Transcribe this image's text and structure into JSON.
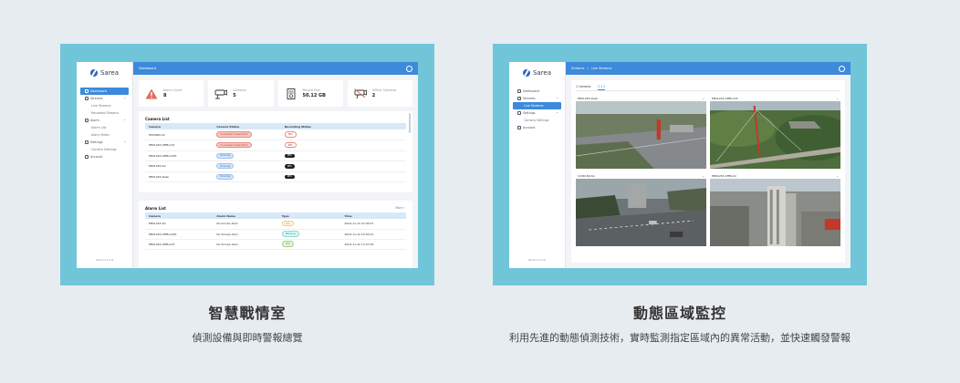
{
  "left": {
    "sidebar": {
      "brand": "Sarea",
      "items": [
        {
          "label": "Dashboard"
        },
        {
          "label": "Streams"
        },
        {
          "label": "Live Streams"
        },
        {
          "label": "Recorded Streams"
        },
        {
          "label": "Alarm"
        },
        {
          "label": "Alarm List"
        },
        {
          "label": "Alarm Rules"
        },
        {
          "label": "Settings"
        },
        {
          "label": "Camera Settings"
        },
        {
          "label": "Account"
        }
      ],
      "version": "Version 1.0.6"
    },
    "topbar": {
      "title": "Dashboard"
    },
    "stats": [
      {
        "label": "Alarm Count",
        "value": "8",
        "icon": "alarm-icon"
      },
      {
        "label": "Cameras",
        "value": "5",
        "icon": "camera-icon"
      },
      {
        "label": "Record Size",
        "value": "50.12 GB",
        "icon": "file-icon"
      },
      {
        "label": "Offline Cameras",
        "value": "2",
        "icon": "camera-off-icon"
      }
    ],
    "camera_list": {
      "title": "Camera List",
      "headers": [
        "Camera",
        "Camera Status",
        "Recording Status"
      ],
      "rows": [
        {
          "camera": "EPSONM-32",
          "status": "Connected Invalid Error",
          "status_color": "red",
          "recording": "REC",
          "rec_style": "off"
        },
        {
          "camera": "EB01265-OffBuild7",
          "status": "Connected Invalid Error",
          "status_color": "red",
          "recording": "REC",
          "rec_style": "off"
        },
        {
          "camera": "EB01265-OffBuild18",
          "status": "Running",
          "status_color": "blue",
          "recording": "REC",
          "rec_style": "on"
        },
        {
          "camera": "EB01265-SG",
          "status": "Running",
          "status_color": "blue",
          "recording": "REC",
          "rec_style": "on"
        },
        {
          "camera": "EB01265-Desk",
          "status": "Running",
          "status_color": "blue",
          "recording": "REC",
          "rec_style": "on"
        }
      ]
    },
    "alarm_list": {
      "title": "Alarm List",
      "more": "More",
      "headers": [
        "Camera",
        "Alarm Name",
        "Type",
        "Time"
      ],
      "rows": [
        {
          "camera": "EB01265-SG",
          "name": "No Smoke Alert",
          "type": "Info",
          "type_color": "yellow",
          "time": "2024-11-12 22:00:01"
        },
        {
          "camera": "EB01265-OffBuild18",
          "name": "No Smoke Alert",
          "type": "Warning",
          "type_color": "teal",
          "time": "2024-11-12 19:45:21"
        },
        {
          "camera": "EB01265-OffBuild7",
          "name": "No Smoke Alert",
          "type": "Info",
          "type_color": "green",
          "time": "2024-11-12 13:27:09"
        }
      ]
    }
  },
  "right": {
    "sidebar": {
      "brand": "Sarea",
      "items": [
        {
          "label": "Dashboard"
        },
        {
          "label": "Streams"
        },
        {
          "label": "Live Streams"
        },
        {
          "label": "Settings"
        },
        {
          "label": "Camera Settings"
        },
        {
          "label": "Account"
        }
      ],
      "version": "Version 1.0.6"
    },
    "topbar": {
      "crumb1": "Streams",
      "sep": "/",
      "crumb2": "Live Streams"
    },
    "tabs": [
      "1 Camera",
      "2 x 2"
    ],
    "cameras": [
      {
        "name": "EB01265-Desk"
      },
      {
        "name": "EB01265-OffBuild3"
      },
      {
        "name": "C296169-SG"
      },
      {
        "name": "EB01265-OffBuild"
      }
    ]
  },
  "captions": {
    "left_title": "智慧戰情室",
    "left_sub": "偵測設備與即時警報總覽",
    "right_title": "動態區域監控",
    "right_sub": "利用先進的動態偵測技術，實時監測指定區域內的異常活動，並快速觸發警報"
  },
  "colors": {
    "panel": "#70c6d8",
    "accent": "#3d89db",
    "background": "#e7ecf1"
  }
}
